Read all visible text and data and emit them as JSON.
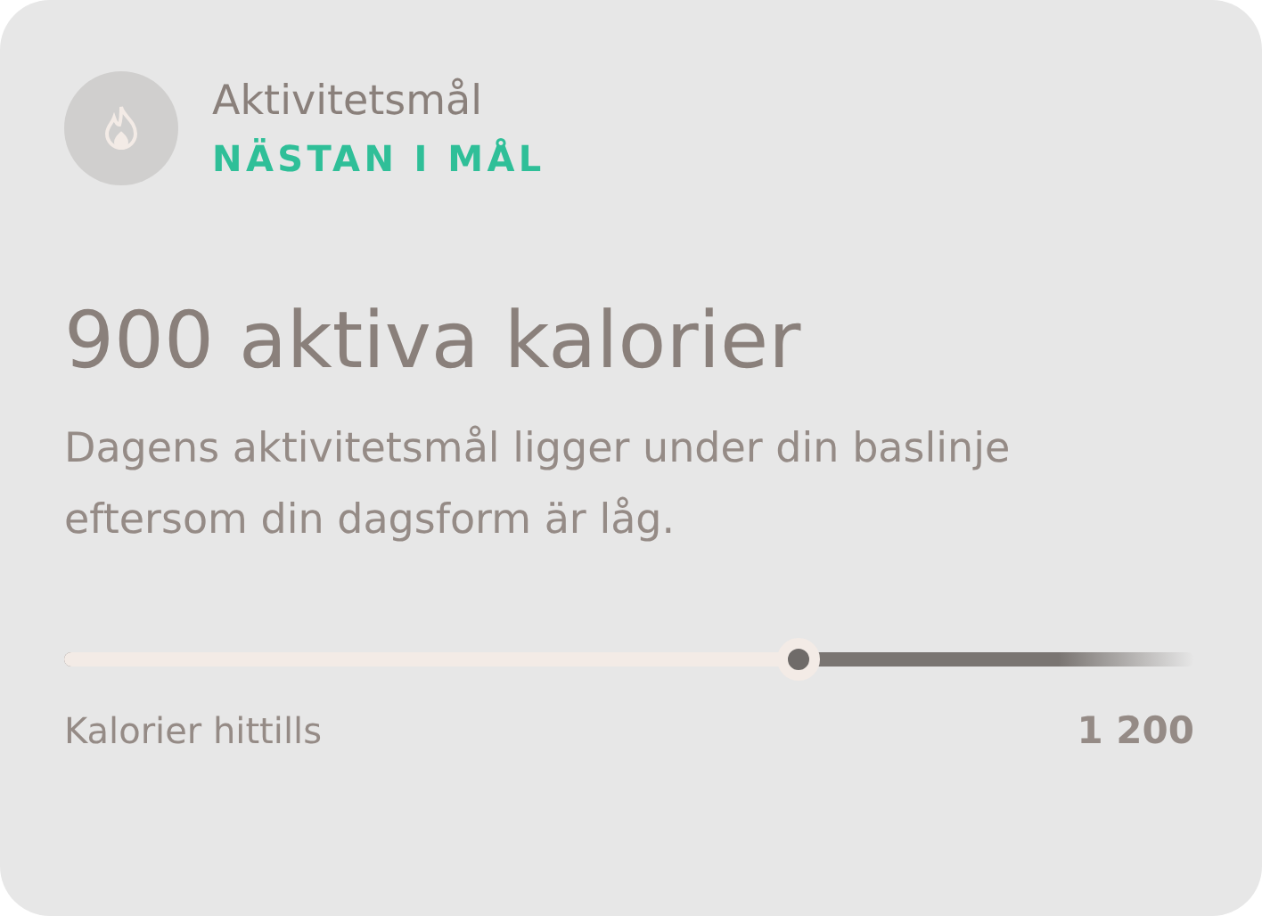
{
  "header": {
    "title": "Aktivitetsmål",
    "status": "NÄSTAN I MÅL"
  },
  "headline": "900 aktiva kalorier",
  "description": "Dagens aktivitetsmål ligger under din baslinje eftersom din dagsform är låg.",
  "progress": {
    "level": 0.65,
    "label": "Kalorier hittills",
    "goal": "1 200"
  }
}
